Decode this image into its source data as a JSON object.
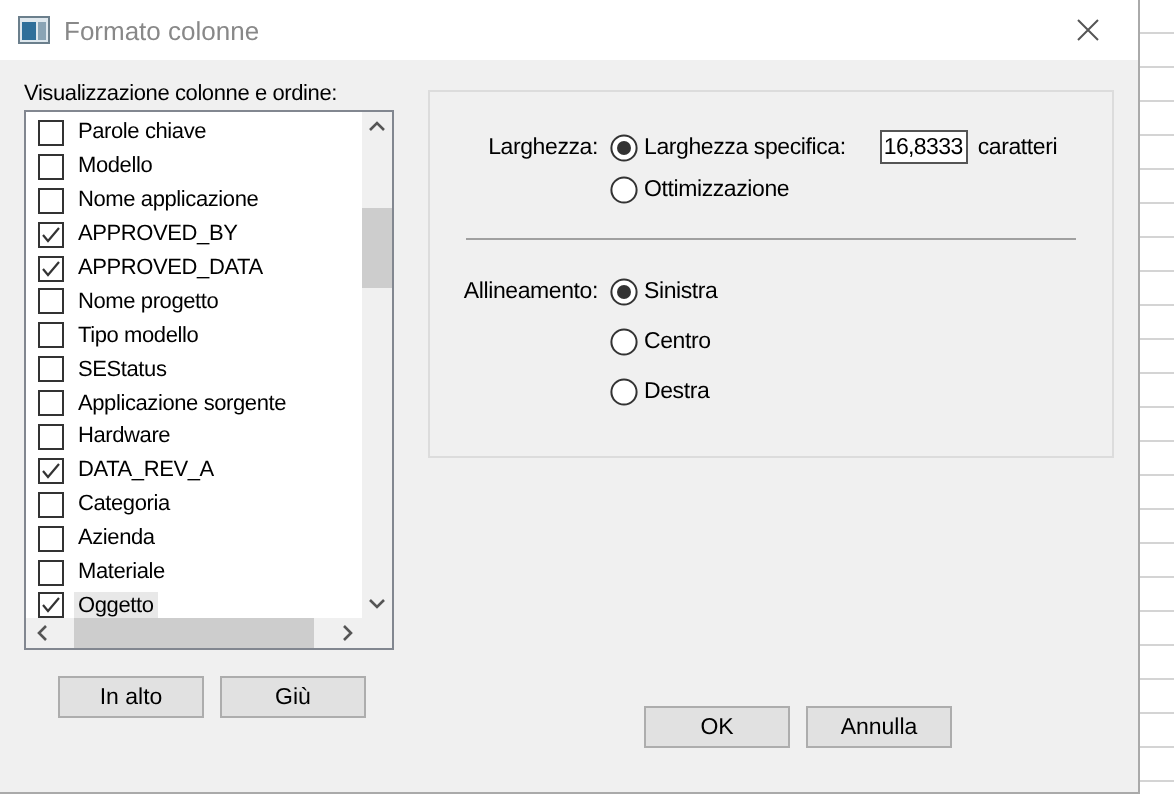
{
  "window": {
    "title": "Formato colonne"
  },
  "columns_list": {
    "label": "Visualizzazione colonne e ordine:",
    "items": [
      {
        "label": "Parole chiave",
        "checked": false,
        "selected": false
      },
      {
        "label": "Modello",
        "checked": false,
        "selected": false
      },
      {
        "label": "Nome applicazione",
        "checked": false,
        "selected": false
      },
      {
        "label": "APPROVED_BY",
        "checked": true,
        "selected": false
      },
      {
        "label": "APPROVED_DATA",
        "checked": true,
        "selected": false
      },
      {
        "label": "Nome progetto",
        "checked": false,
        "selected": false
      },
      {
        "label": "Tipo modello",
        "checked": false,
        "selected": false
      },
      {
        "label": "SEStatus",
        "checked": false,
        "selected": false
      },
      {
        "label": "Applicazione sorgente",
        "checked": false,
        "selected": false
      },
      {
        "label": "Hardware",
        "checked": false,
        "selected": false
      },
      {
        "label": "DATA_REV_A",
        "checked": true,
        "selected": false
      },
      {
        "label": "Categoria",
        "checked": false,
        "selected": false
      },
      {
        "label": "Azienda",
        "checked": false,
        "selected": false
      },
      {
        "label": "Materiale",
        "checked": false,
        "selected": false
      },
      {
        "label": "Oggetto",
        "checked": true,
        "selected": true
      }
    ]
  },
  "order_buttons": [
    "In alto",
    "Giù"
  ],
  "width": {
    "label": "Larghezza:",
    "options": [
      {
        "label": "Larghezza specifica:",
        "selected": true
      },
      {
        "label": "Ottimizzazione",
        "selected": false
      }
    ],
    "value": "16,8333",
    "unit": "caratteri"
  },
  "alignment": {
    "label": "Allineamento:",
    "options": [
      {
        "label": "Sinistra",
        "selected": true
      },
      {
        "label": "Centro",
        "selected": false
      },
      {
        "label": "Destra",
        "selected": false
      }
    ]
  },
  "buttons": [
    "OK",
    "Annulla"
  ]
}
